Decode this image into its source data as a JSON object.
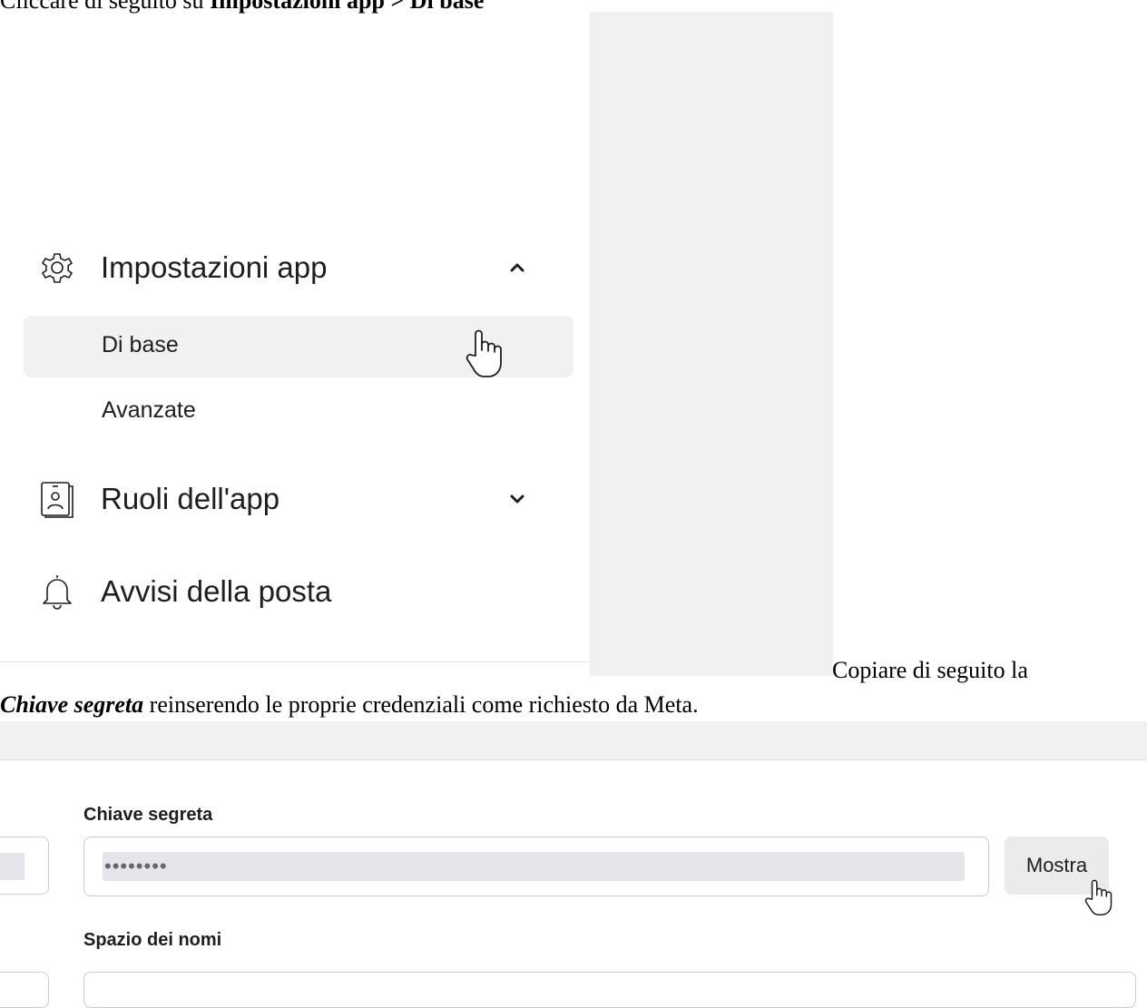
{
  "doc": {
    "intro_prefix": "Cliccare di seguito su ",
    "intro_bold": "Impostazioni app > Di base",
    "copy_line1": "Copiare di seguito la",
    "copy_bold_italic": "Chiave segreta",
    "copy_line2_rest": " reinserendo le proprie credenziali come richiesto da Meta."
  },
  "sidebar": {
    "sections": [
      {
        "label": "Impostazioni app",
        "icon": "gear-icon",
        "expanded": true
      },
      {
        "label": "Ruoli dell'app",
        "icon": "badge-icon",
        "expanded": false
      },
      {
        "label": "Avvisi della posta",
        "icon": "bell-icon"
      }
    ],
    "sub_items": [
      {
        "label": "Di base",
        "active": true
      },
      {
        "label": "Avanzate",
        "active": false
      }
    ]
  },
  "form": {
    "secret_label": "Chiave segreta",
    "secret_masked": "••••••••",
    "show_button": "Mostra",
    "namespace_label": "Spazio dei nomi"
  },
  "colors": {
    "active_bg": "#f0f1f3",
    "text": "#1c1e21",
    "placeholder_gray": "#f0f0f0"
  }
}
